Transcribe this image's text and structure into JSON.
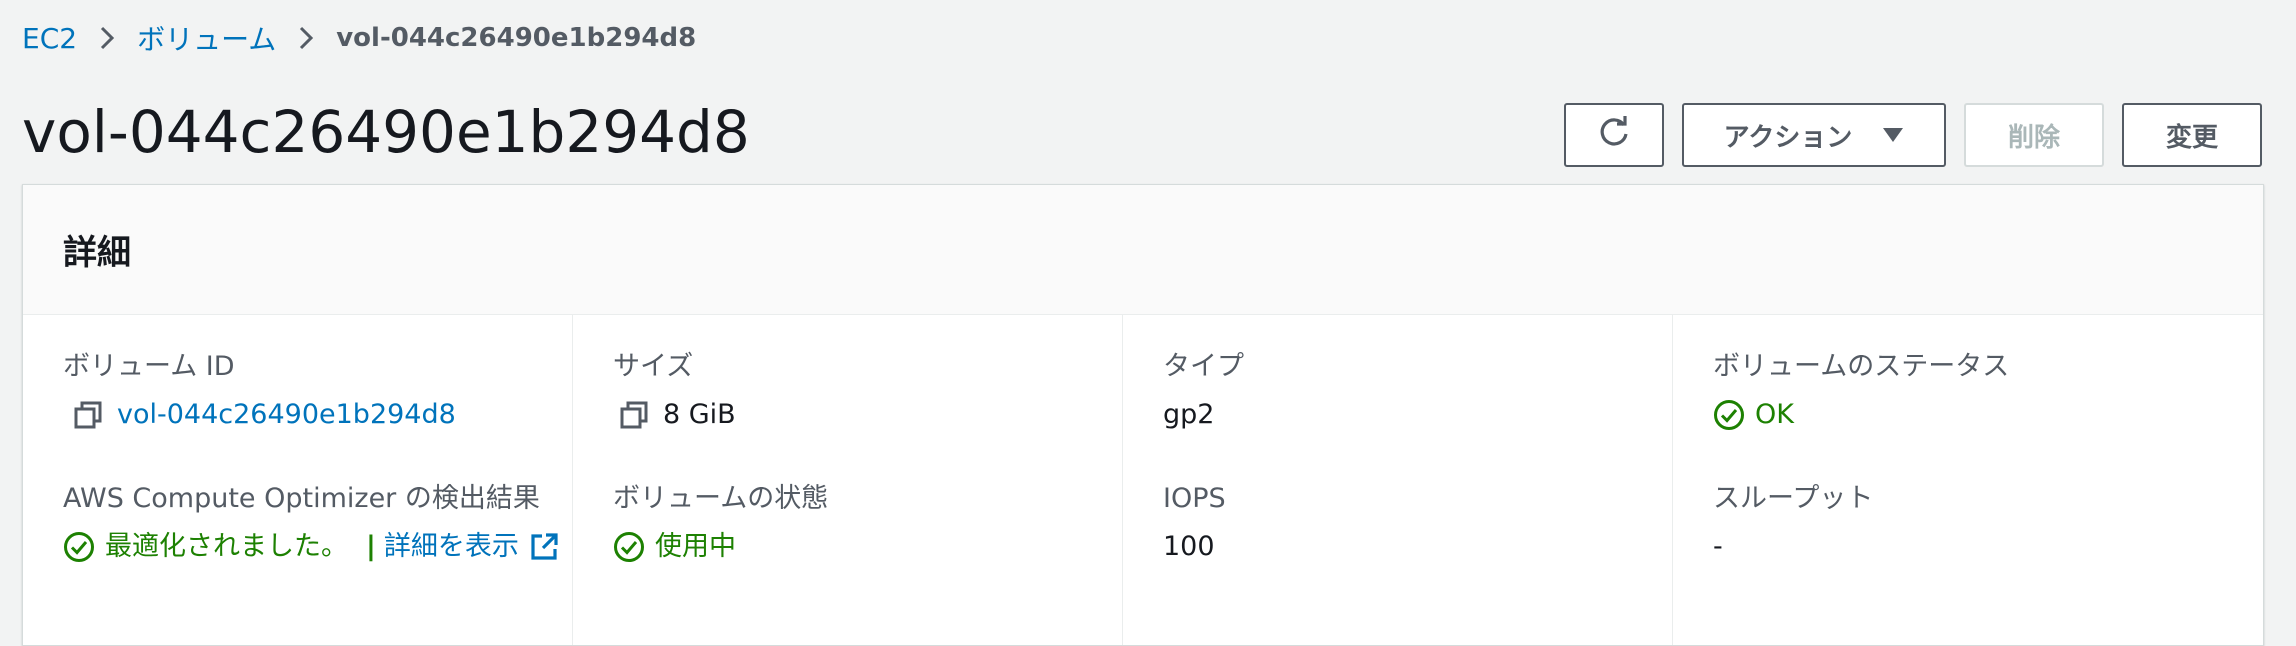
{
  "breadcrumb": {
    "items": [
      "EC2",
      "ボリューム"
    ],
    "current": "vol-044c26490e1b294d8"
  },
  "page": {
    "title": "vol-044c26490e1b294d8"
  },
  "actions": {
    "refresh_icon": "refresh-icon",
    "action_label": "アクション",
    "delete_label": "削除",
    "modify_label": "変更"
  },
  "details": {
    "title": "詳細",
    "volume_id": {
      "label": "ボリューム ID",
      "value": "vol-044c26490e1b294d8"
    },
    "optimizer": {
      "label": "AWS Compute Optimizer の検出結果",
      "status": "最適化されました。",
      "separator": "|",
      "link": "詳細を表示"
    },
    "size": {
      "label": "サイズ",
      "value": "8 GiB"
    },
    "volume_state": {
      "label": "ボリュームの状態",
      "value": "使用中"
    },
    "type": {
      "label": "タイプ",
      "value": "gp2"
    },
    "iops": {
      "label": "IOPS",
      "value": "100"
    },
    "volume_status": {
      "label": "ボリュームのステータス",
      "value": "OK"
    },
    "throughput": {
      "label": "スループット",
      "value": "-"
    }
  },
  "colors": {
    "link": "#0073bb",
    "success": "#1d8102",
    "text": "#16191f",
    "muted": "#545b64",
    "background": "#f2f3f3"
  }
}
